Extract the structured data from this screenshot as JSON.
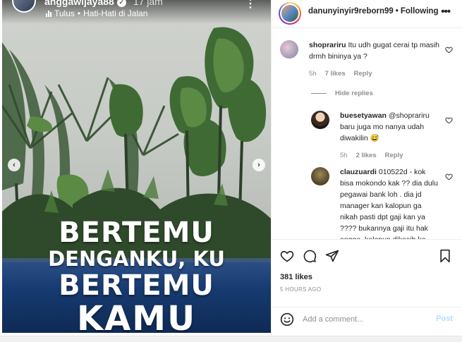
{
  "story": {
    "username": "anggawijaya88",
    "time": "17 jam",
    "music_artist": "Tulus",
    "music_separator": "•",
    "music_title": "Hati-Hati di Jalan",
    "overlay_lines": [
      "BERTEMU",
      "DENGANKU, KU",
      "BERTEMU",
      "KAMU"
    ]
  },
  "post": {
    "username": "danunyinyir9reborn99",
    "separator": "•",
    "follow_label": "Following"
  },
  "comments": [
    {
      "username": "shoprariru",
      "text": "Itu udh gugat cerai tp masih drmh bininya ya ?",
      "time": "5h",
      "likes": "7 likes",
      "reply_label": "Reply"
    },
    {
      "username": "buesetyawan",
      "text": "@shoprariru baru juga mo nanya udah diwakilin 😅",
      "time": "5h",
      "likes": "2 likes",
      "reply_label": "Reply"
    },
    {
      "username": "clauzuardi",
      "text": "010522d - kok bisa mokondo kak ?? dia dulu pegawai bank loh . dia jd manager kan kalopun ga nikah pasti dpt gaji kan ya ???? bukannya gaji itu hak angga, kalopun dikasih ke"
    }
  ],
  "hide_replies_label": "Hide replies",
  "actions": {
    "likes": "381 likes",
    "timestamp": "5 HOURS AGO"
  },
  "add_comment": {
    "placeholder": "Add a comment...",
    "post_label": "Post"
  },
  "icons": {
    "like": "heart-icon",
    "comment": "comment-icon",
    "share": "paper-plane-icon",
    "save": "bookmark-icon",
    "emoji": "smiley-icon",
    "more": "more-dots-icon"
  },
  "colors": {
    "text": "#262626",
    "muted": "#8e8e8e",
    "post_disabled": "#b2dffc",
    "overlay_text": "#ffffff"
  }
}
